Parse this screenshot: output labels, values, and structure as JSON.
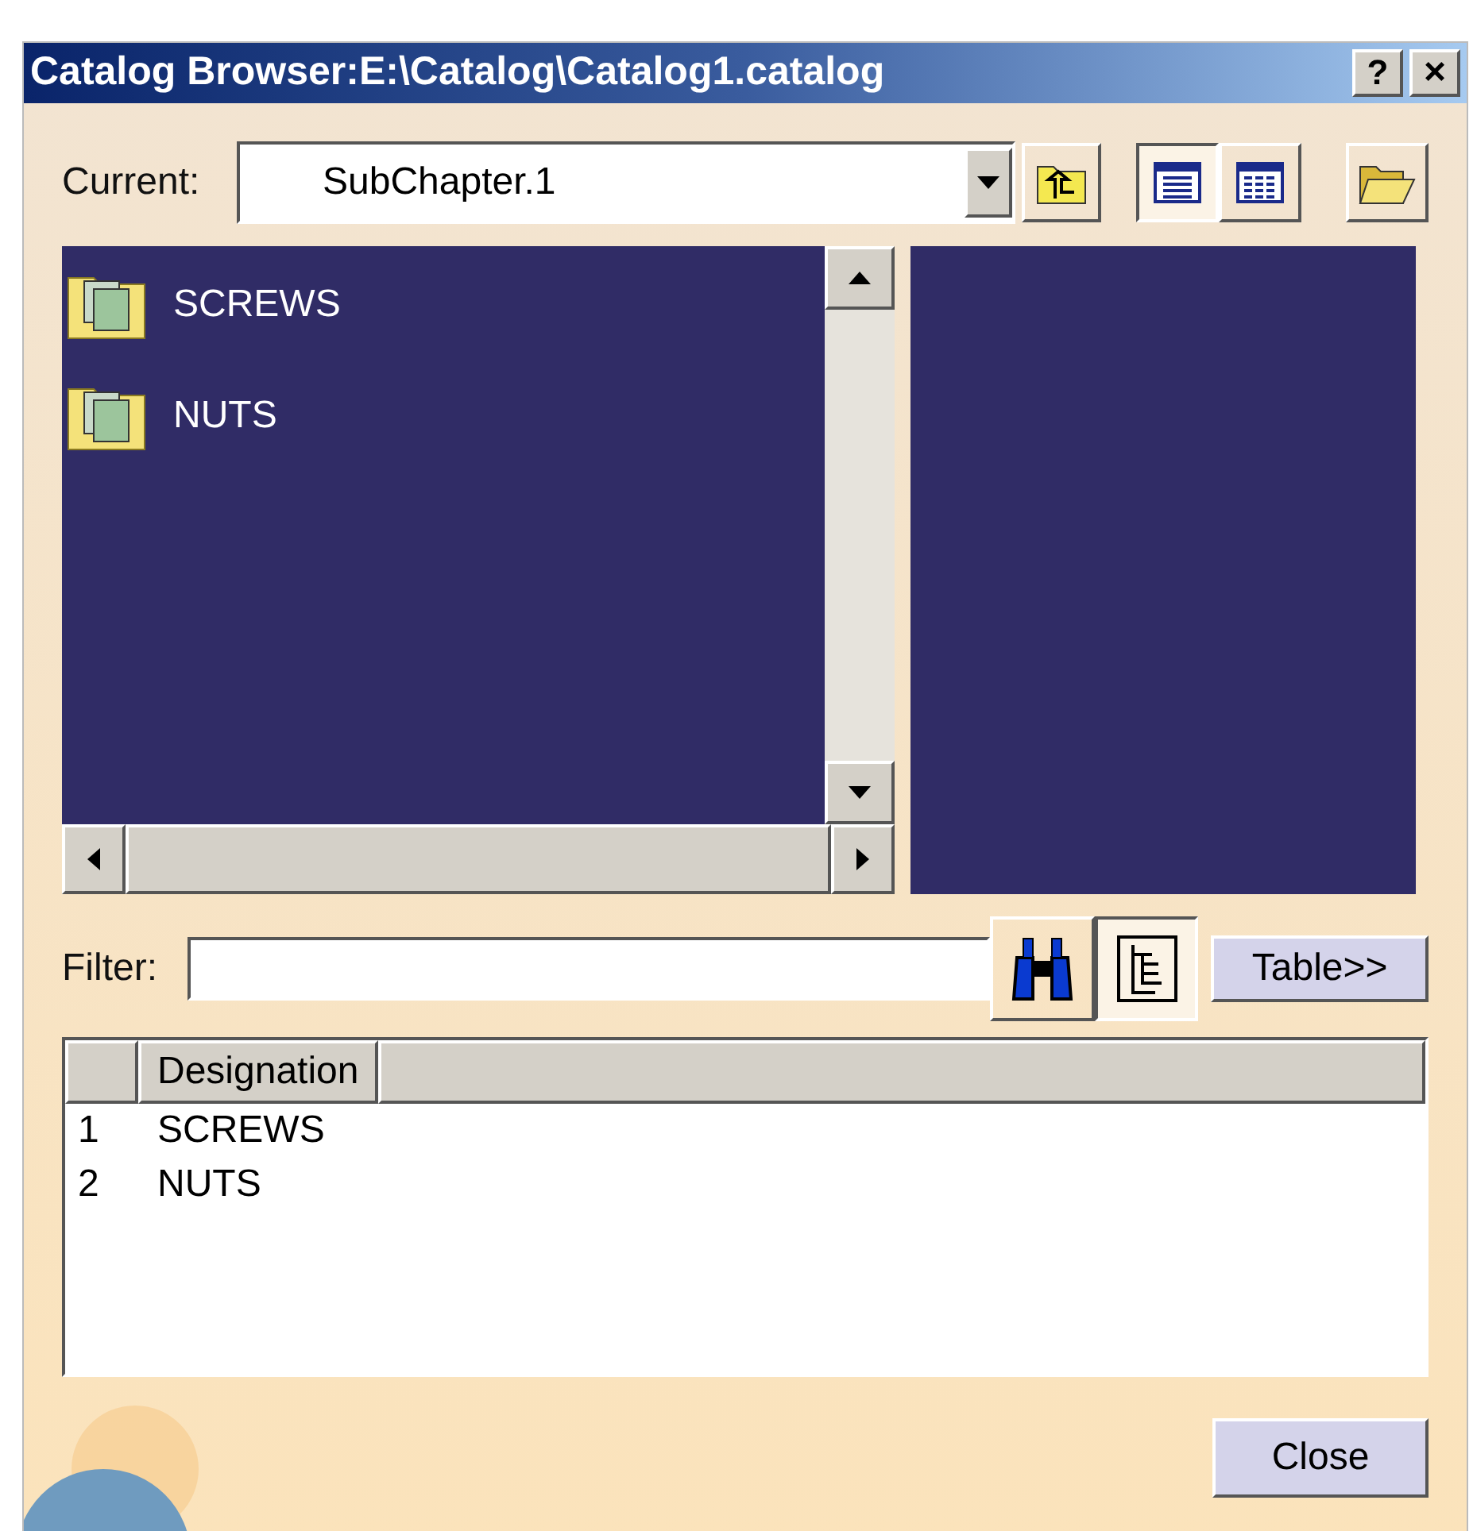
{
  "window": {
    "title": "Catalog Browser:E:\\Catalog\\Catalog1.catalog",
    "help_button": "?",
    "close_button": "×"
  },
  "current": {
    "label": "Current:",
    "value": "SubChapter.1"
  },
  "view_modes": [
    {
      "kind": "list",
      "selected": true
    },
    {
      "kind": "details",
      "selected": false
    }
  ],
  "items": [
    {
      "name": "SCREWS"
    },
    {
      "name": "NUTS"
    }
  ],
  "filter": {
    "label": "Filter:"
  },
  "tree_toggle": {
    "selected": true
  },
  "table_button": "Table>>",
  "table": {
    "columns": [
      "Designation"
    ],
    "rows": [
      {
        "index": "1",
        "designation": "SCREWS"
      },
      {
        "index": "2",
        "designation": "NUTS"
      }
    ]
  },
  "close_button": "Close"
}
